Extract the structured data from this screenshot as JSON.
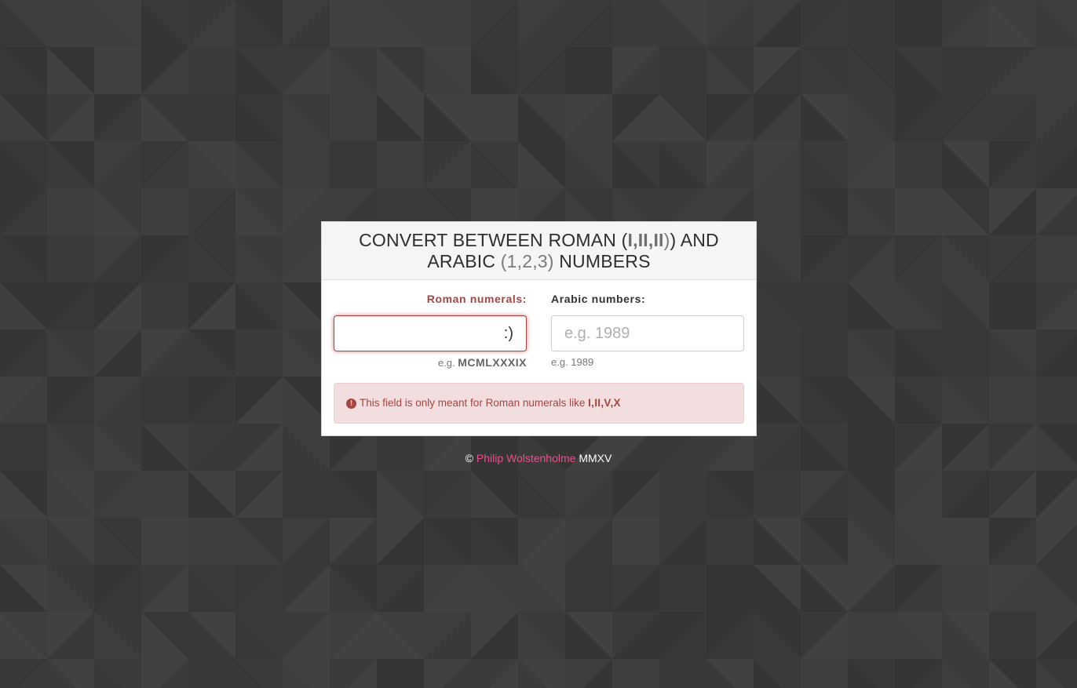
{
  "background": {
    "color": "#3a3a3a",
    "pattern": "triangles"
  },
  "header": {
    "title_part1": "CONVERT BETWEEN ROMAN (",
    "title_roman_example": "I,II,II",
    "title_part2": ") AND",
    "title_part3": "ARABIC ",
    "title_arabic_example": "(1,2,3)",
    "title_part4": " NUMBERS"
  },
  "roman": {
    "label": "Roman numerals:",
    "value": ":)",
    "hint_prefix": "e.g. ",
    "hint_example": "MCMLXXXIX",
    "error_color": "#a94442"
  },
  "arabic": {
    "label": "Arabic numbers:",
    "placeholder": "e.g. 1989",
    "hint": "e.g. 1989"
  },
  "alert": {
    "icon": "exclamation-circle-icon",
    "text": "This field is only meant for Roman numerals like ",
    "examples": "I,II,V,X",
    "background": "#f2dede"
  },
  "footer": {
    "copyright": "© ",
    "author": "Philip Wolstenholme",
    "year": " MMXV",
    "link_color": "#e8508f"
  }
}
